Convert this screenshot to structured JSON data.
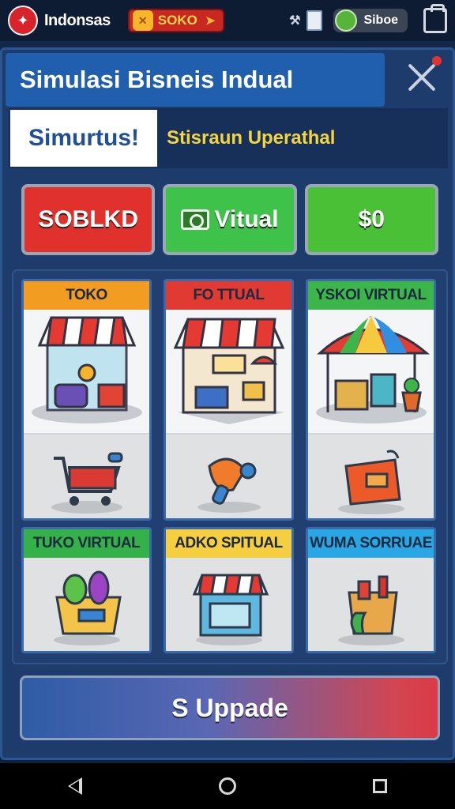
{
  "status_bar": {
    "region": "Indonsas",
    "currency_label": "SOKO",
    "user_name": "Siboe",
    "icons": [
      "flag-icon",
      "coin-icon",
      "signal-icon",
      "sim-icon",
      "user-avatar-icon",
      "bag-icon"
    ]
  },
  "panel": {
    "title": "Simulasi Bisneis Indual",
    "tab_label": "Simurtus!",
    "subtitle": "Stisraun Uperathal"
  },
  "actions": [
    {
      "label": "SOBLKD",
      "color": "#e0312d"
    },
    {
      "label": "Vitual",
      "color": "#3ec24a"
    },
    {
      "label": "$0",
      "color": "#49c036"
    }
  ],
  "stores": [
    {
      "label": "TOKO",
      "header_color": "#f29d22"
    },
    {
      "label": "FO TTUAL",
      "header_color": "#e03a32"
    },
    {
      "label": "YSKOI VIRTUAL",
      "header_color": "#3cb64a"
    },
    {
      "label": "TUKO VIRTUAL",
      "header_color": "#35b14a"
    },
    {
      "label": "ADKO SPITUAL",
      "header_color": "#f5cf3f"
    },
    {
      "label": "WUMA SORRUAE",
      "header_color": "#28a7e4"
    }
  ],
  "upgrade_label": "S Uppade",
  "nav": {
    "icons": [
      "back-icon",
      "home-icon",
      "recents-icon"
    ]
  }
}
